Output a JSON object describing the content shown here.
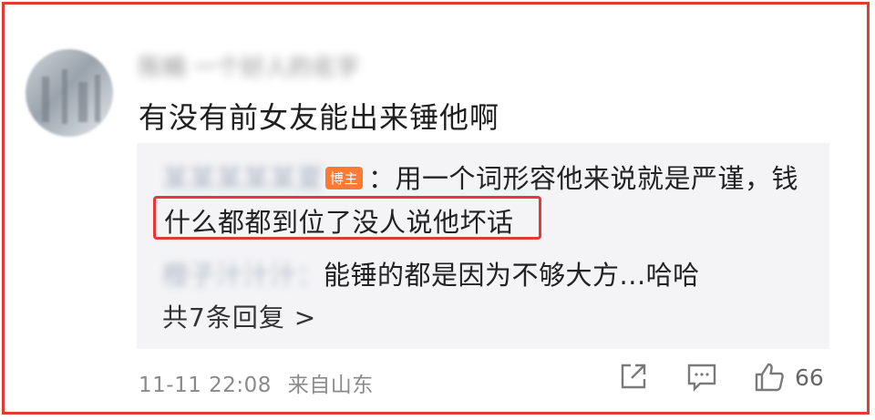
{
  "comment": {
    "username": "陈楠 一个好人的名字",
    "text": "有没有前女友能出来锤他啊"
  },
  "replies": [
    {
      "name": "某某某某某夏",
      "badge": "博主",
      "separator": "：",
      "text_line1": "用一个词形容他来说就是严谨，钱",
      "text_line2": "什么都都到位了没人说他坏话"
    },
    {
      "name": "橙子汁汁汁",
      "separator": "：",
      "text": "能锤的都是因为不够大方...哈哈"
    }
  ],
  "more_replies_label": "共7条回复 >",
  "meta": {
    "timestamp": "11-11 22:08",
    "location": "来自山东"
  },
  "actions": {
    "like_count": "66",
    "share_icon": "share-icon",
    "comment_icon": "comment-icon",
    "like_icon": "thumbs-up-icon"
  },
  "colors": {
    "highlight": "#e53935",
    "badge": "#ff7a33",
    "reply_bg": "#f4f4f6"
  }
}
